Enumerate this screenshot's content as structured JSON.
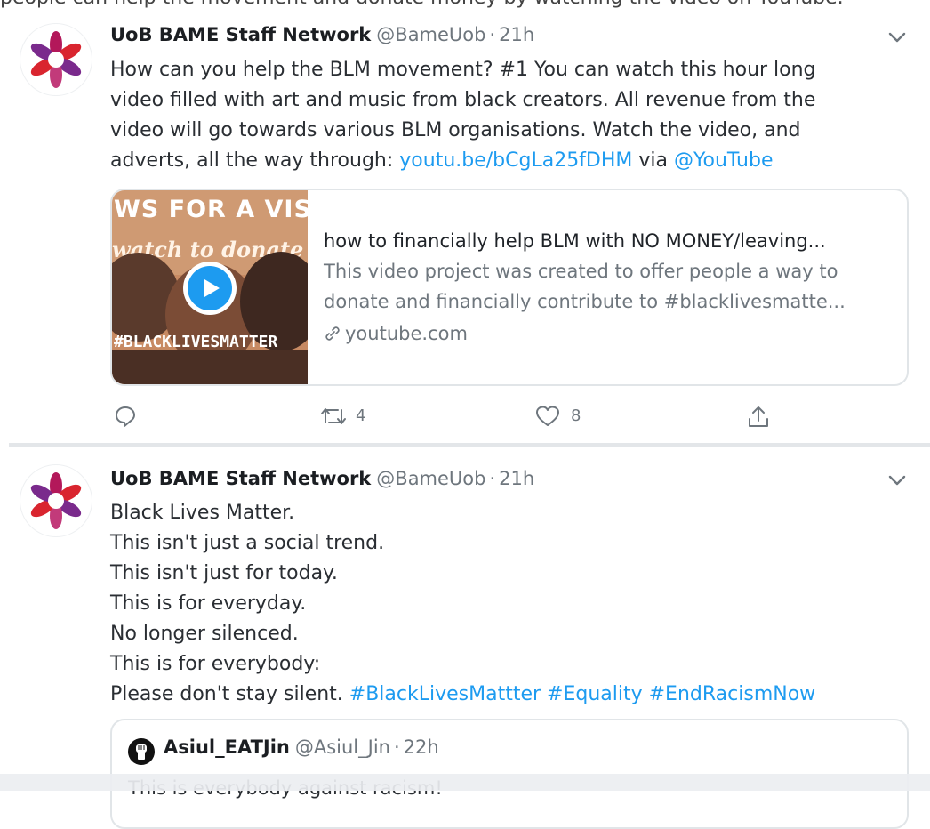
{
  "top_strip": {
    "text": "people can help the movement and donate money by watching the video on YouTube.",
    "accent": ""
  },
  "tweets": [
    {
      "name": "UoB BAME Staff Network",
      "handle": "@BameUob",
      "separator": "·",
      "time": "21h",
      "text_lines": [
        "How can you help the BLM movement? #1 You can watch this hour long",
        "video filled with art and music from black creators. All revenue from the",
        "video will go towards various BLM organisations. Watch the video, and"
      ],
      "text_last_prefix": "adverts, all the way through: ",
      "link_url": "youtu.be/bCgLa25fDHM",
      "via_word": " via ",
      "via_mention": "@YouTube",
      "card": {
        "thumb_line1": "WS FOR A VIS",
        "thumb_line2": "watch to donate",
        "thumb_line3": "#BLACKLIVESMATTER",
        "title": "how to financially help BLM with NO MONEY/leaving...",
        "desc_line1": "This video project was created to offer people a way to",
        "desc_line2": "donate and financially contribute to #blacklivesmatte...",
        "domain": "youtube.com"
      },
      "actions": {
        "reply_count": "",
        "retweet_count": "4",
        "like_count": "8"
      }
    },
    {
      "name": "UoB BAME Staff Network",
      "handle": "@BameUob",
      "separator": "·",
      "time": "21h",
      "text_lines": [
        "Black Lives Matter.",
        "This isn't just a social trend.",
        "This isn't just for today.",
        "This is for everyday.",
        "No longer silenced.",
        "This is for everybody:"
      ],
      "text_last_prefix": "Please don't stay silent. ",
      "hashtags": "#BlackLivesMattter #Equality #EndRacismNow",
      "quote": {
        "name": "Asiul_EATJin",
        "handle": "@Asiul_Jin",
        "separator": "·",
        "time": "22h",
        "text": "This is everybody against racism!"
      }
    }
  ],
  "colors": {
    "link": "#1d9bf0",
    "muted": "#6e767d",
    "text": "#2a2e33",
    "avatar_petals": [
      "#b3185a",
      "#7a2a8c",
      "#d9252f",
      "#c23a7a"
    ]
  },
  "icons": [
    "network-logo-icon",
    "chevron-down-icon",
    "play-icon",
    "link-icon",
    "reply-icon",
    "retweet-icon",
    "like-icon",
    "share-icon",
    "raised-fist-icon"
  ]
}
